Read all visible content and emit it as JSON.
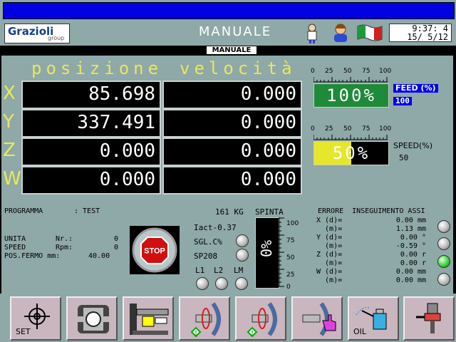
{
  "header": {
    "logo_main": "Grazioli",
    "logo_sub": "group",
    "title": "MANUALE",
    "clock_time": "9:37: 4",
    "clock_date": "15/ 5/12"
  },
  "subbar": {
    "label": "MANUALE"
  },
  "columns": {
    "position": "posizione",
    "speed": "velocità"
  },
  "axes": [
    {
      "name": "X",
      "position": "85.698",
      "speed": "0.000"
    },
    {
      "name": "Y",
      "position": "337.491",
      "speed": "0.000"
    },
    {
      "name": "Z",
      "position": "0.000",
      "speed": "0.000"
    },
    {
      "name": "W",
      "position": "0.000",
      "speed": "0.000"
    }
  ],
  "feed": {
    "scale_labels": [
      "0",
      "25",
      "50",
      "75",
      "100"
    ],
    "value_text": "100%",
    "percent": 100,
    "label": "FEED (%)",
    "value": "100",
    "color": "#1f8a3a"
  },
  "speed": {
    "scale_labels": [
      "0",
      "25",
      "50",
      "75",
      "100"
    ],
    "value_text": "50%",
    "percent": 50,
    "label": "SPEED(%)",
    "value": "50",
    "color": "#e6e62a"
  },
  "program": {
    "label": "PROGRAMMA",
    "value": ": TEST",
    "unit_label": "UNITA",
    "nr_label": "Nr.:",
    "nr_value": "0",
    "speed_label": "SPEED",
    "rpm_label": "Rpm:",
    "rpm_value": "0",
    "posfermo_label": "POS.FERMO mm:",
    "posfermo_value": "40.00"
  },
  "stop_label": "STOP",
  "status": {
    "iact": "Iact-0.37",
    "sgl": "SGL.C%",
    "sp": "SP208",
    "l1": "L1",
    "l2": "L2",
    "lm": "LM"
  },
  "spinta": {
    "value": "161 KG",
    "label": "SPINTA",
    "percent": 0,
    "value_text": "0%",
    "scale_labels": [
      "100",
      "75",
      "50",
      "25",
      "0"
    ]
  },
  "errors": {
    "title": "ERRORE  INSEGUIMENTO ASSI",
    "rows": [
      {
        "label": "X (d)=",
        "value": "0.00 mm",
        "led": "grey"
      },
      {
        "label": "  (m)=",
        "value": "1.13 mm",
        "led": "grey"
      },
      {
        "label": "Y (d)=",
        "value": "0.00 °",
        "led": "grey"
      },
      {
        "label": "  (m)=",
        "value": "-0.59 °",
        "led": "grey"
      },
      {
        "label": "Z (d)=",
        "value": "0.00 r",
        "led": "green"
      },
      {
        "label": "  (m)=",
        "value": "0.00 r",
        "led": "grey"
      },
      {
        "label": "W (d)=",
        "value": "0.00 mm",
        "led": "grey"
      },
      {
        "label": "  (m)=",
        "value": "0.00 mm",
        "led": "grey"
      }
    ]
  },
  "function_keys": [
    {
      "icon": "crosshair-icon",
      "label": "SET"
    },
    {
      "icon": "clamp-icon",
      "label": ""
    },
    {
      "icon": "machine-icon",
      "label": ""
    },
    {
      "icon": "rotate-left-icon",
      "label": ""
    },
    {
      "icon": "rotate-right-icon",
      "label": ""
    },
    {
      "icon": "spindle-hand-icon",
      "label": ""
    },
    {
      "icon": "oil-can-icon",
      "label": "OIL"
    },
    {
      "icon": "spray-icon",
      "label": ""
    }
  ]
}
